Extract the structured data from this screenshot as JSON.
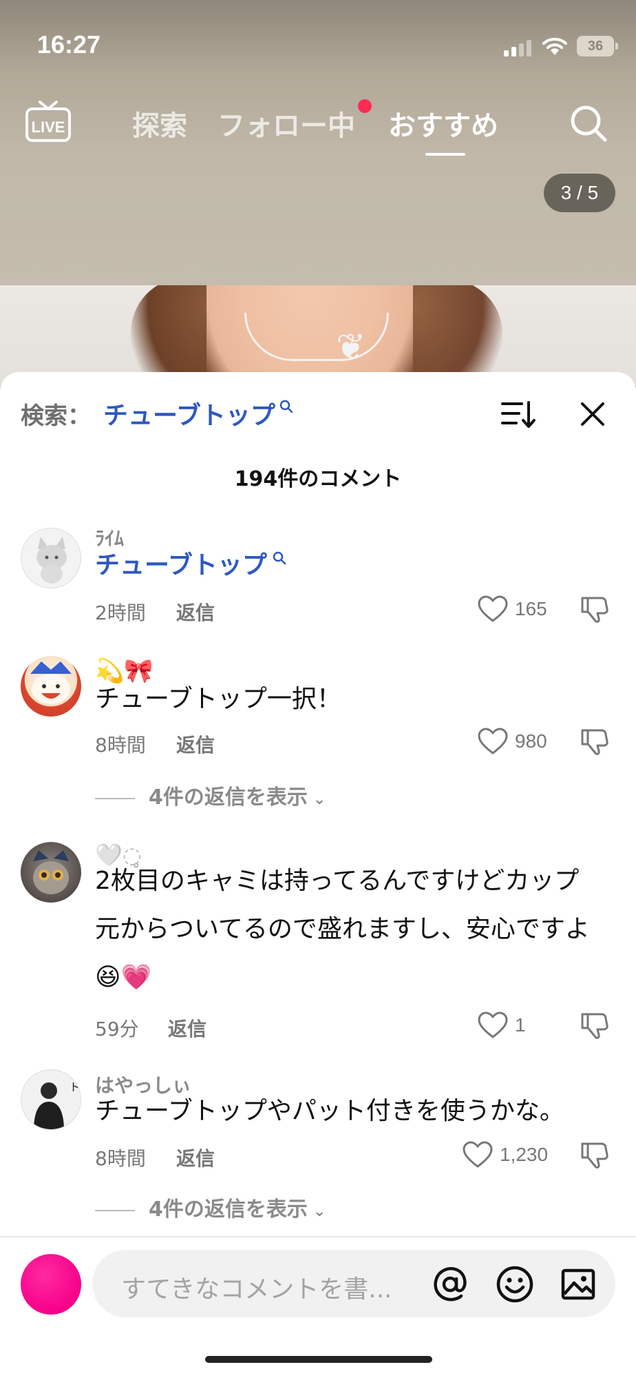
{
  "status_bar": {
    "time": "16:27",
    "battery": "36"
  },
  "top_nav": {
    "tabs": [
      {
        "label": "探索",
        "active": false
      },
      {
        "label": "フォロー中",
        "active": false,
        "has_notification_dot": true
      },
      {
        "label": "おすすめ",
        "active": true
      }
    ],
    "page_indicator": "3 / 5"
  },
  "comments_sheet": {
    "search_label": "検索：",
    "search_term": "チューブトップ",
    "comment_count": "194件のコメント",
    "comments": [
      {
        "username": "ﾗｲﾑ",
        "text": "チューブトップ",
        "is_search_link": true,
        "time": "2時間",
        "reply_label": "返信",
        "likes": "165"
      },
      {
        "username": "💫🎀",
        "text": "チューブトップ一択！",
        "time": "8時間",
        "reply_label": "返信",
        "likes": "980",
        "view_replies": "4件の返信を表示"
      },
      {
        "username": "🤍◌̥",
        "text_lines": [
          "2枚目のキャミは持ってるんですけどカップ",
          "元からついてるので盛れますし、安心ですよ",
          "😆💗"
        ],
        "time": "59分",
        "reply_label": "返信",
        "likes": "1"
      },
      {
        "username": "はやっしぃ",
        "text": "チューブトップやパット付きを使うかな。",
        "time": "8時間",
        "reply_label": "返信",
        "likes": "1,230",
        "view_replies": "4件の返信を表示"
      }
    ]
  },
  "composer": {
    "placeholder": "すてきなコメントを書..."
  },
  "colors": {
    "link_blue": "#2d58c0",
    "notification_red": "#fe2c55",
    "my_avatar": "#f7008a"
  }
}
